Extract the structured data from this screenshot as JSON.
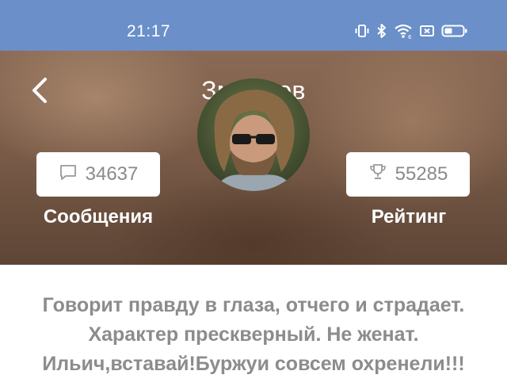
{
  "status_bar": {
    "time": "21:17",
    "icons": [
      "vibrate-icon",
      "bluetooth-icon",
      "wifi-icon",
      "sim-off-icon",
      "battery-icon"
    ]
  },
  "header": {
    "title": "Змеенов",
    "back_icon": "chevron-left-icon"
  },
  "stats": {
    "messages": {
      "icon": "chat-bubble-icon",
      "value": "34637",
      "label": "Сообщения"
    },
    "rating": {
      "icon": "trophy-icon",
      "value": "55285",
      "label": "Рейтинг"
    }
  },
  "avatar": {
    "alt": "user-avatar"
  },
  "bio": {
    "lines": [
      "Говорит правду в глаза, отчего и страдает.",
      "Характер прескверный. Не женат.",
      "Ильич,вставай!Буржуи совсем охренели!!!"
    ]
  },
  "colors": {
    "status_bar": "#6a8fc9",
    "hero_bg": "#7a5c48",
    "bio_text": "#8c8c8c",
    "stat_text": "#8a8a8a"
  }
}
